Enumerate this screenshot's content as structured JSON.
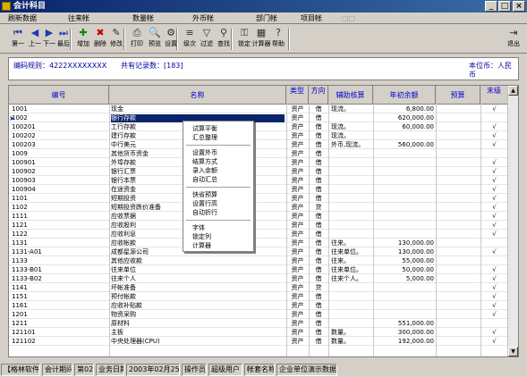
{
  "window": {
    "title": "会计科目",
    "controls": [
      "_",
      "□",
      "×"
    ]
  },
  "menu": [
    {
      "label": "刷新数据",
      "enabled": true
    },
    {
      "label": "往来帐",
      "enabled": true
    },
    {
      "label": "数量帐",
      "enabled": true
    },
    {
      "label": "外币帐",
      "enabled": true
    },
    {
      "label": "部门帐",
      "enabled": true
    },
    {
      "label": "项目帐",
      "enabled": true
    },
    {
      "label": "□□",
      "enabled": false
    }
  ],
  "toolbar": [
    {
      "label": "第一",
      "icon": "first-icon",
      "glyph": "⏮"
    },
    {
      "label": "上一",
      "icon": "prev-icon",
      "glyph": "◀"
    },
    {
      "label": "下一",
      "icon": "next-icon",
      "glyph": "▶"
    },
    {
      "label": "最后",
      "icon": "last-icon",
      "glyph": "⏭"
    },
    {
      "label": "增加",
      "icon": "add-icon",
      "glyph": "✚"
    },
    {
      "label": "删除",
      "icon": "delete-icon",
      "glyph": "✖"
    },
    {
      "label": "修改",
      "icon": "edit-icon",
      "glyph": "✎"
    },
    {
      "label": "打印",
      "icon": "print-icon",
      "glyph": "⎙"
    },
    {
      "label": "预览",
      "icon": "preview-icon",
      "glyph": "🔍"
    },
    {
      "label": "设置",
      "icon": "settings-icon",
      "glyph": "⚙"
    },
    {
      "label": "级次",
      "icon": "level-icon",
      "glyph": "≡"
    },
    {
      "label": "过滤",
      "icon": "filter-icon",
      "glyph": "▽"
    },
    {
      "label": "查找",
      "icon": "find-icon",
      "glyph": "⚲"
    },
    {
      "label": "锁定",
      "icon": "lock-icon",
      "glyph": "⚿"
    },
    {
      "label": "计算器",
      "icon": "calculator-icon",
      "glyph": "▦"
    },
    {
      "label": "帮助",
      "icon": "help-icon",
      "glyph": "?"
    },
    {
      "label": "退出",
      "icon": "exit-icon",
      "glyph": "⇥"
    }
  ],
  "info": {
    "code_rule": "编码规则：4222XXXXXXXX",
    "record_count": "共有记录数：[183]",
    "currency": "本位币：人民币"
  },
  "grid": {
    "headers": [
      "编号",
      "名称",
      "类型",
      "方向",
      "辅助核算",
      "年初余额",
      "预算",
      "末级"
    ],
    "rows": [
      [
        "1001",
        "现金",
        "资产",
        "借",
        "现流。",
        "6,800.00",
        "",
        "√"
      ],
      [
        "1002",
        "银行存款",
        "资产",
        "借",
        "",
        "620,000.00",
        "",
        ""
      ],
      [
        "100201",
        "工行存款",
        "资产",
        "借",
        "现流。",
        "60,000.00",
        "",
        "√"
      ],
      [
        "100202",
        "建行存款",
        "资产",
        "借",
        "现流。",
        "",
        "",
        "√"
      ],
      [
        "100203",
        "中行美元",
        "资产",
        "借",
        "外币,现流。",
        "560,000.00",
        "",
        "√"
      ],
      [
        "1009",
        "其他货币资金",
        "资产",
        "借",
        "",
        "",
        "",
        ""
      ],
      [
        "100901",
        "外埠存款",
        "资产",
        "借",
        "",
        "",
        "",
        "√"
      ],
      [
        "100902",
        "银行汇票",
        "资产",
        "借",
        "",
        "",
        "",
        "√"
      ],
      [
        "100903",
        "银行本票",
        "资产",
        "借",
        "",
        "",
        "",
        "√"
      ],
      [
        "100904",
        "在途资金",
        "资产",
        "借",
        "",
        "",
        "",
        "√"
      ],
      [
        "1101",
        "短期投资",
        "资产",
        "借",
        "",
        "",
        "",
        "√"
      ],
      [
        "1102",
        "短期投资跌价准备",
        "资产",
        "贷",
        "",
        "",
        "",
        "√"
      ],
      [
        "1111",
        "应收票据",
        "资产",
        "借",
        "",
        "",
        "",
        "√"
      ],
      [
        "1121",
        "应收股利",
        "资产",
        "借",
        "",
        "",
        "",
        "√"
      ],
      [
        "1122",
        "应收利息",
        "资产",
        "借",
        "",
        "",
        "",
        "√"
      ],
      [
        "1131",
        "应收帐款",
        "资产",
        "借",
        "往来。",
        "130,000.00",
        "",
        ""
      ],
      [
        "1131-A01",
        "成都星源公司",
        "资产",
        "借",
        "往来单位。",
        "130,000.00",
        "",
        "√"
      ],
      [
        "1133",
        "其他应收款",
        "资产",
        "借",
        "往来。",
        "55,000.00",
        "",
        ""
      ],
      [
        "1133-B01",
        "往来单位",
        "资产",
        "借",
        "往来单位。",
        "50,000.00",
        "",
        "√"
      ],
      [
        "1133-B02",
        "往来个人",
        "资产",
        "借",
        "往来个人。",
        "5,000.00",
        "",
        "√"
      ],
      [
        "1141",
        "坏帐准备",
        "资产",
        "贷",
        "",
        "",
        "",
        "√"
      ],
      [
        "1151",
        "预付帐款",
        "资产",
        "借",
        "",
        "",
        "",
        "√"
      ],
      [
        "1161",
        "应收补贴款",
        "资产",
        "借",
        "",
        "",
        "",
        "√"
      ],
      [
        "1201",
        "物资采购",
        "资产",
        "借",
        "",
        "",
        "",
        "√"
      ],
      [
        "1211",
        "原材料",
        "资产",
        "借",
        "",
        "551,000.00",
        "",
        ""
      ],
      [
        "121101",
        "主板",
        "资产",
        "借",
        "数量。",
        "300,000.00",
        "",
        "√"
      ],
      [
        "121102",
        "中央处理器(CPU)",
        "资产",
        "借",
        "数量。",
        "192,000.00",
        "",
        "√"
      ]
    ]
  },
  "context_menu": [
    [
      "试算平衡",
      "汇总整理"
    ],
    [
      "设置外币",
      "结算方式",
      "录入余额",
      "自动汇总"
    ],
    [
      "快省预算",
      "设置行高",
      "自动折行"
    ],
    [
      "字体",
      "锁定列",
      "计算器"
    ]
  ],
  "status": [
    "【格林软件】",
    "会计期间",
    "第02期",
    "业务日期",
    "2003年02月25日",
    "操作员",
    "超级用户",
    "帐套名称",
    "企业单位演示数据"
  ]
}
